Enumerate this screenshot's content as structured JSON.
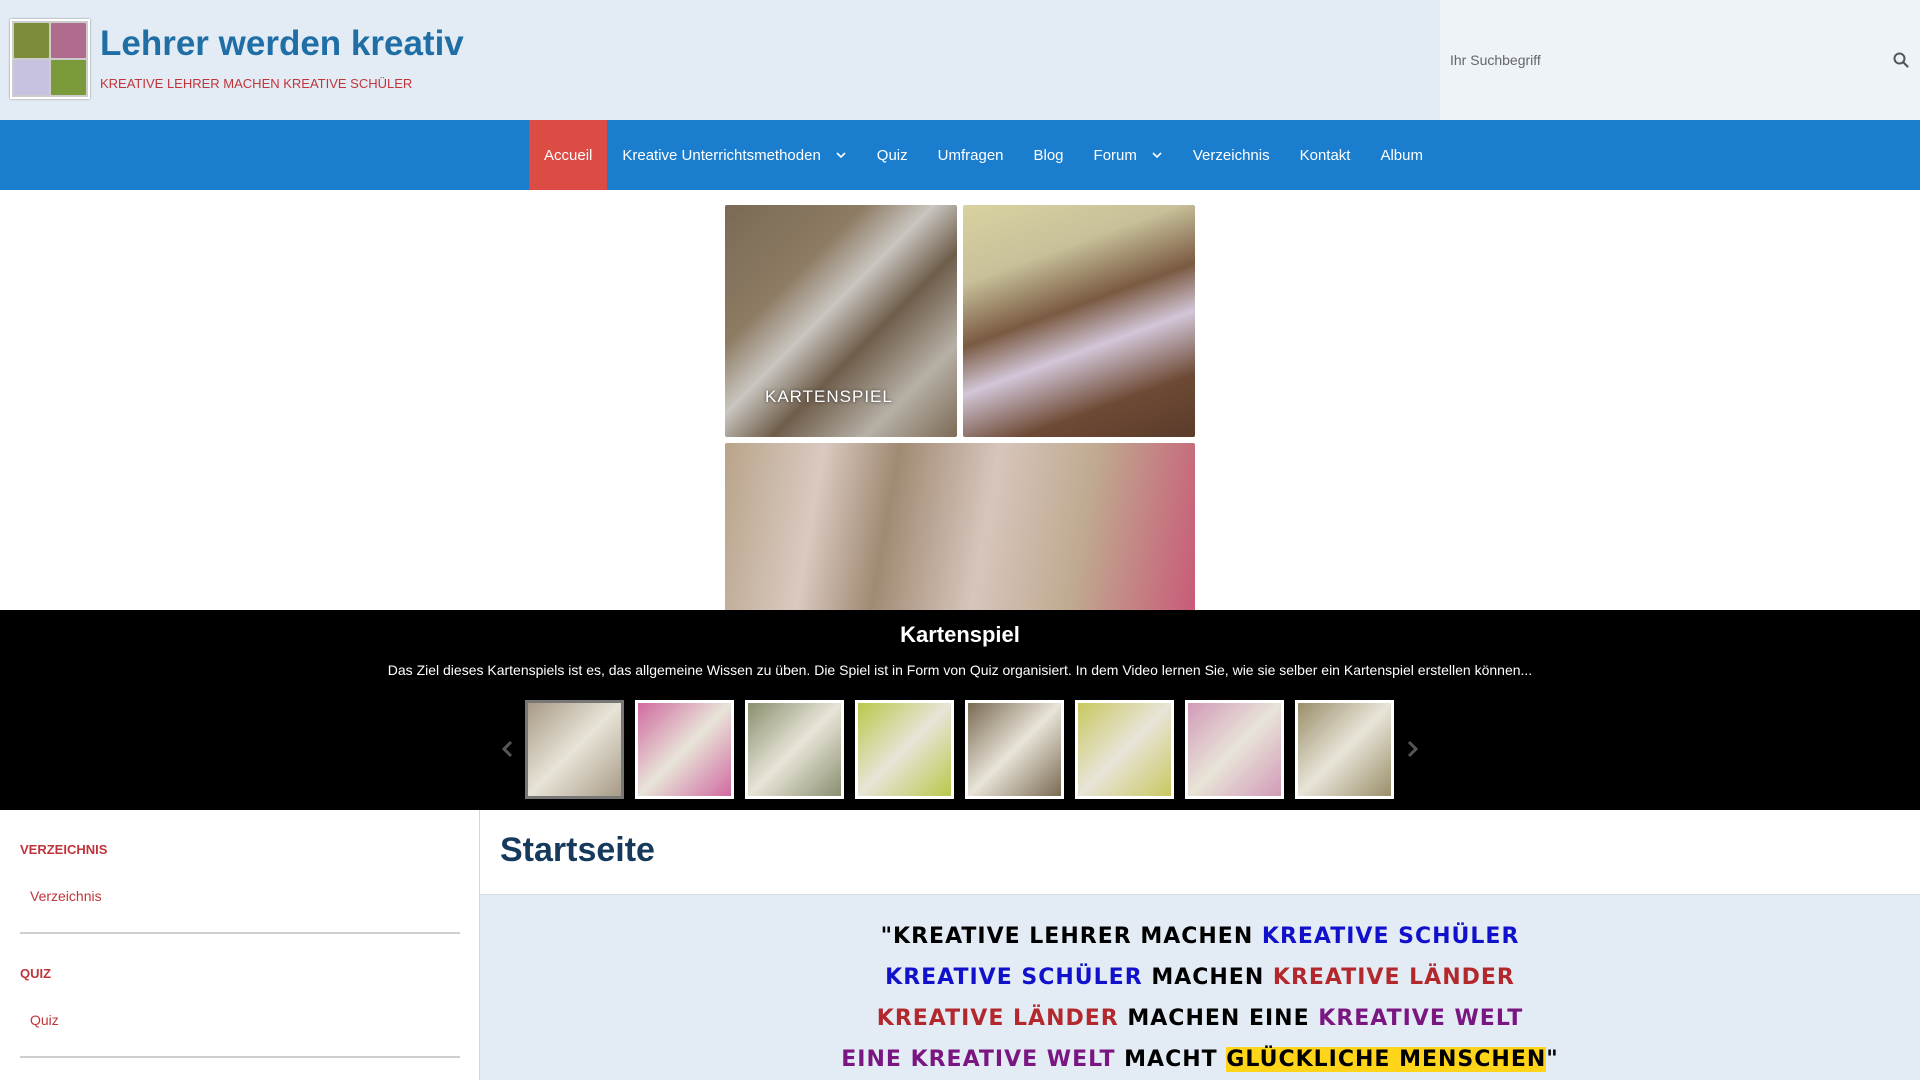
{
  "header": {
    "title": "Lehrer werden kreativ",
    "slogan": "KREATIVE LEHRER MACHEN KREATIVE SCHÜLER",
    "search_placeholder": "Ihr Suchbegriff"
  },
  "nav": {
    "items": [
      {
        "label": "Accueil",
        "active": true
      },
      {
        "label": "Kreative Unterrichtsmethoden",
        "dropdown": true
      },
      {
        "label": "Quiz"
      },
      {
        "label": "Umfragen"
      },
      {
        "label": "Blog"
      },
      {
        "label": "Forum",
        "dropdown": true
      },
      {
        "label": "Verzeichnis"
      },
      {
        "label": "Kontakt"
      },
      {
        "label": "Album"
      }
    ]
  },
  "slideshow": {
    "image_label": "KARTENSPIEL",
    "caption_title": "Kartenspiel",
    "caption_text": "Das Ziel dieses Kartenspiels ist es, das allgemeine Wissen zu üben. Die Spiel ist in Form von Quiz organisiert. In dem Video lernen Sie, wie sie selber ein Kartenspiel erstellen können...",
    "selected_index": 0,
    "thumbnail_colors": [
      "#a79a86",
      "#d06aa0",
      "#8a8f6e",
      "#b9c84a",
      "#7a6a52",
      "#c8c860",
      "#d29ab8",
      "#9a8f6a"
    ],
    "prev_icon": "chevron-left-icon",
    "next_icon": "chevron-right-icon"
  },
  "sidebar": {
    "sections": [
      {
        "heading": "VERZEICHNIS",
        "link": "Verzeichnis"
      },
      {
        "heading": "QUIZ",
        "link": "Quiz"
      }
    ]
  },
  "main": {
    "page_title": "Startseite",
    "quote": {
      "line1": {
        "open": "\"",
        "a": "KREATIVE LEHRER MACHEN ",
        "b": "KREATIVE SCHÜLER"
      },
      "line2": {
        "a": "KREATIVE  SCHÜLER",
        "b": " MACHEN ",
        "c": "KREATIVE LÄNDER"
      },
      "line3": {
        "a": "KREATIVE LÄNDER",
        "b": " MACHEN EINE ",
        "c": "KREATIVE WELT"
      },
      "line4": {
        "a": "EINE KREATIVE WELT",
        "b": " MACHT ",
        "c": "GLÜCKLICHE MENSCHEN",
        "close": "\""
      }
    }
  },
  "colors": {
    "header_bg": "#e3ecf4",
    "nav_bg": "#1a7dce",
    "nav_active": "#dc4b44",
    "title_blue": "#1f6ea6",
    "accent_red": "#c0343b",
    "highlight_yellow": "#ffd51a"
  }
}
